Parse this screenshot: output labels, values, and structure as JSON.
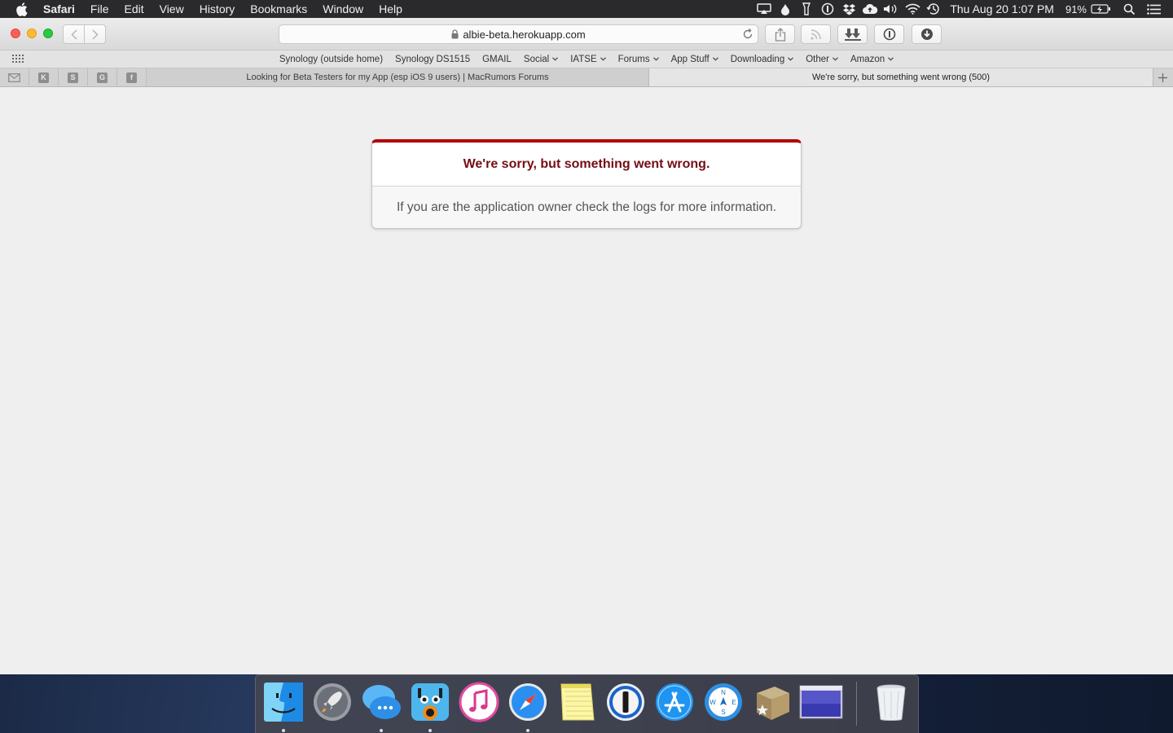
{
  "menubar": {
    "app_name": "Safari",
    "items": [
      "File",
      "Edit",
      "View",
      "History",
      "Bookmarks",
      "Window",
      "Help"
    ],
    "clock": "Thu Aug 20  1:07 PM",
    "battery_percent": "91%"
  },
  "toolbar": {
    "url": "albie-beta.herokuapp.com"
  },
  "favorites": [
    {
      "label": "Synology (outside home)",
      "has_menu": false
    },
    {
      "label": "Synology DS1515",
      "has_menu": false
    },
    {
      "label": "GMAIL",
      "has_menu": false
    },
    {
      "label": "Social",
      "has_menu": true
    },
    {
      "label": "IATSE",
      "has_menu": true
    },
    {
      "label": "Forums",
      "has_menu": true
    },
    {
      "label": "App Stuff",
      "has_menu": true
    },
    {
      "label": "Downloading",
      "has_menu": true
    },
    {
      "label": "Other",
      "has_menu": true
    },
    {
      "label": "Amazon",
      "has_menu": true
    }
  ],
  "pinned_tabs": [
    "mail",
    "K",
    "S",
    "G",
    "f"
  ],
  "tabs": [
    {
      "title": "Looking for Beta Testers for my App (esp iOS 9 users) | MacRumors Forums",
      "active": false
    },
    {
      "title": "We're sorry, but something went wrong (500)",
      "active": true
    }
  ],
  "page": {
    "error_title": "We're sorry, but something went wrong.",
    "error_message": "If you are the application owner check the logs for more information."
  },
  "dock": {
    "apps": [
      "finder",
      "launchpad",
      "messages",
      "tweetbot",
      "itunes",
      "safari",
      "notes",
      "1password",
      "app-store",
      "compass",
      "archive",
      "screen",
      "trash"
    ],
    "running": [
      "finder",
      "messages",
      "tweetbot",
      "safari"
    ]
  },
  "colors": {
    "error_accent": "#b00100",
    "error_title": "#730e15"
  }
}
